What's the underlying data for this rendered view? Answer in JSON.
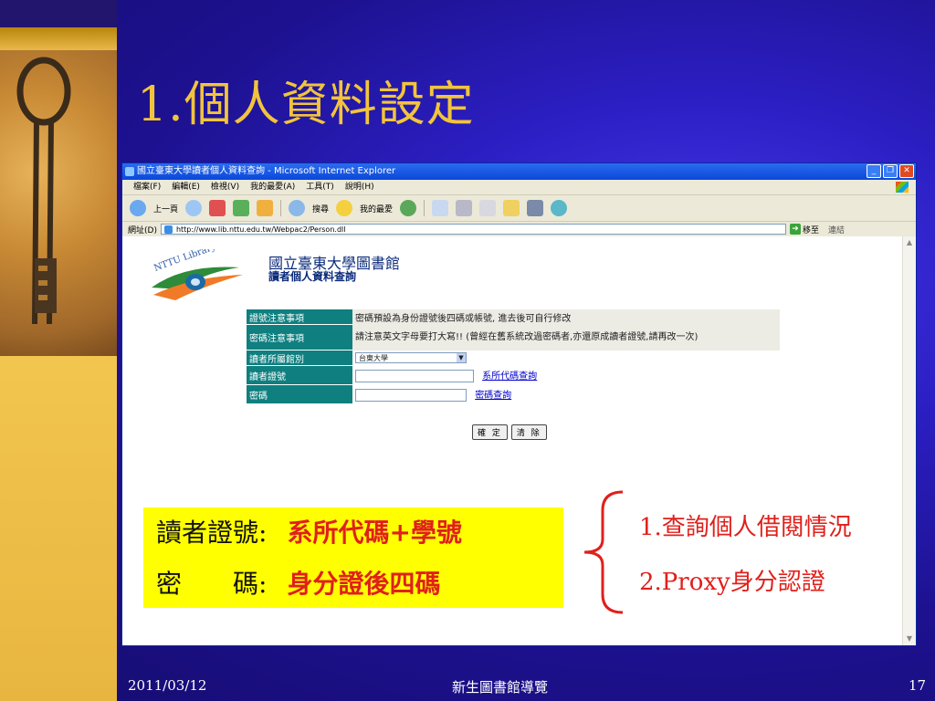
{
  "slide": {
    "title": "1.個人資料設定",
    "footer_date": "2011/03/12",
    "footer_center": "新生圖書館導覽",
    "footer_page": "17"
  },
  "browser": {
    "window_title": "國立臺東大學讀者個人資料查詢 - Microsoft Internet Explorer",
    "menu": [
      "檔案(F)",
      "編輯(E)",
      "檢視(V)",
      "我的最愛(A)",
      "工具(T)",
      "說明(H)"
    ],
    "toolbar": {
      "back": "上一頁",
      "search": "搜尋",
      "favorites": "我的最愛"
    },
    "address_label": "網址(D)",
    "address_url": "http://www.lib.nttu.edu.tw/Webpac2/Person.dll",
    "go_label": "移至",
    "links_label": "連結"
  },
  "page": {
    "logo_text": "NTTU Library",
    "library_name": "國立臺東大學圖書館",
    "page_heading": "讀者個人資料查詢",
    "form": {
      "rows": [
        {
          "label": "證號注意事項",
          "value": "密碼預設為身份證號後四碼或帳號, 進去後可自行修改"
        },
        {
          "label": "密碼注意事項",
          "value": "請注意英文字母要打大寫!! (曾經在舊系統改過密碼者,亦還原成讀者證號,請再改一次)"
        },
        {
          "label": "讀者所屬館別",
          "value": "台東大學"
        },
        {
          "label": "讀者證號",
          "value": "",
          "link": "系所代碼查詢"
        },
        {
          "label": "密碼",
          "value": "",
          "link": "密碼查詢"
        }
      ],
      "confirm_button": "確 定",
      "clear_button": "清 除"
    }
  },
  "overlay": {
    "note_reader_label": "讀者證號:",
    "note_reader_value": "系所代碼+學號",
    "note_pw_label": "密　　碼:",
    "note_pw_value": "身分證後四碼",
    "annot_1": "1.查詢個人借閱情況",
    "annot_2": "2.Proxy身分認證"
  }
}
